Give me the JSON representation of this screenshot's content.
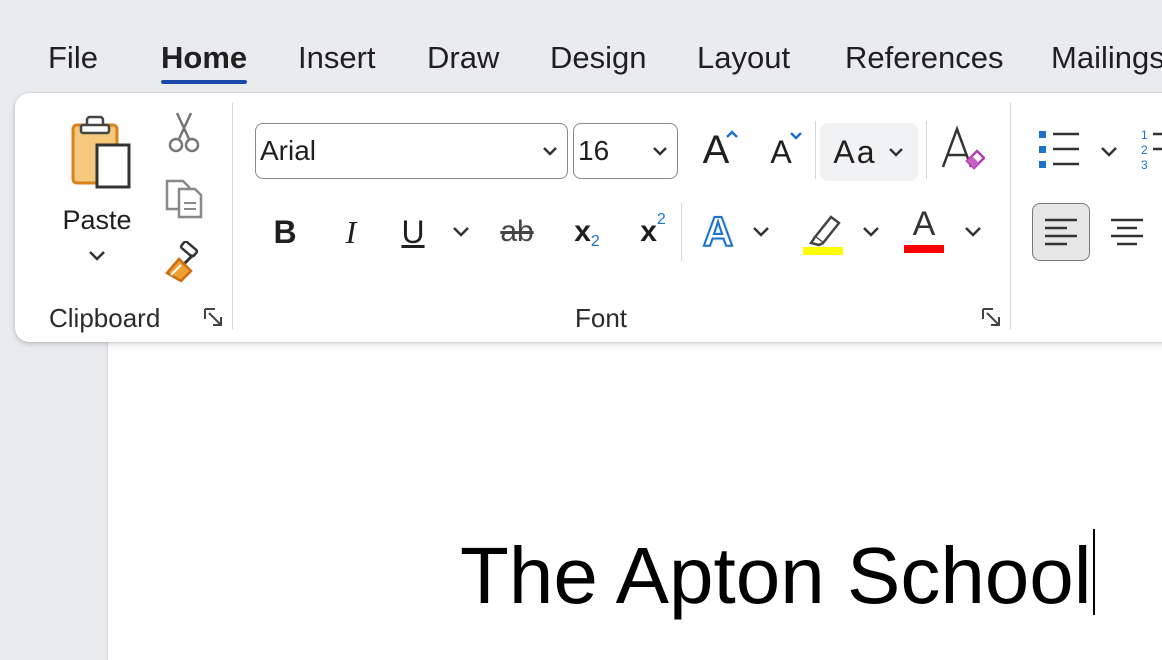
{
  "tabs": [
    "File",
    "Home",
    "Insert",
    "Draw",
    "Design",
    "Layout",
    "References",
    "Mailings"
  ],
  "active_tab": "Home",
  "ribbon": {
    "clipboard": {
      "paste_label": "Paste",
      "group_label": "Clipboard",
      "icons": [
        "paste-icon",
        "cut-icon",
        "copy-icon",
        "format-painter-icon"
      ]
    },
    "font": {
      "font_name": "Arial",
      "font_size": "16",
      "change_case_label": "Aa",
      "bold": "B",
      "italic": "I",
      "underline": "U",
      "strikethrough": "ab",
      "subscript": "x",
      "subscript_index": "2",
      "superscript": "x",
      "superscript_index": "2",
      "grow_font": "A",
      "shrink_font": "A",
      "text_effects": "A",
      "font_color": "A",
      "group_label": "Font",
      "highlight_color": "#ffff00",
      "font_color_value": "#ff0000"
    },
    "paragraph": {
      "icons": [
        "bullets-icon",
        "numbering-icon",
        "align-left-icon",
        "align-center-icon"
      ]
    }
  },
  "document": {
    "text": "The Apton School"
  },
  "colors": {
    "accent": "#1a4aa8",
    "background": "#e9ebef"
  }
}
